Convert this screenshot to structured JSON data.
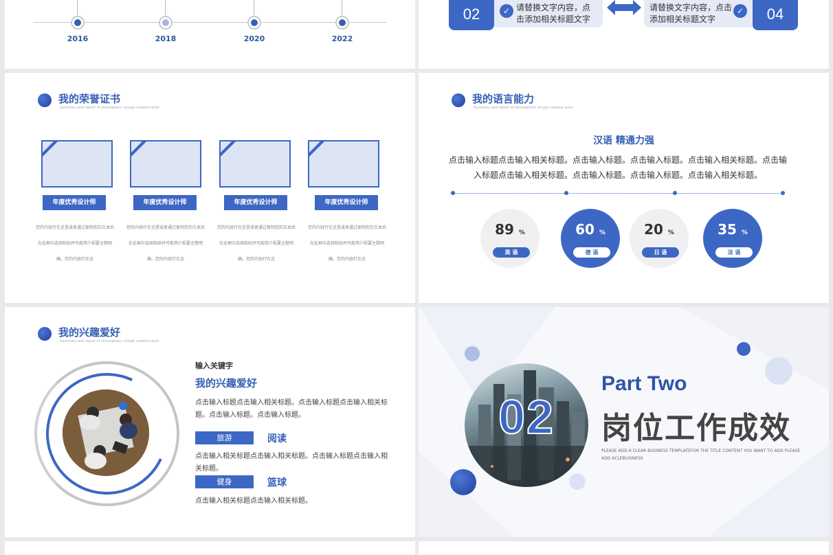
{
  "timeline": {
    "years": [
      "2016",
      "2018",
      "2020",
      "2022"
    ]
  },
  "steps": {
    "left_num": "02",
    "left_text": "请替换文字内容，点击添加相关标题文字",
    "right_num": "04",
    "right_text": "请替换文字内容，点击添加相关标题文字",
    "check_icon": "check-icon",
    "arrow_icon": "double-arrow-icon"
  },
  "honors": {
    "title": "我的荣誉证书",
    "subtitle": "Summary and report of atmospheric simple creative work",
    "items": [
      {
        "label": "年度优秀设计师",
        "desc": "您的内容打在这里或者通过复制您的文本后在此框中选择粘贴并可能简介扼要主题明确。您的内容打在这"
      },
      {
        "label": "年度优秀设计师",
        "desc": "您的内容打在这里或者通过复制您的文本后在此框中选择粘贴并可能简介扼要主题明确。您的内容打在这"
      },
      {
        "label": "年度优秀设计师",
        "desc": "您的内容打在这里或者通过复制您的文本后在此框中选择粘贴并可能简介扼要主题明确。您的内容打在这"
      },
      {
        "label": "年度优秀设计师",
        "desc": "您的内容打在这里或者通过复制您的文本后在此框中选择粘贴并可能简介扼要主题明确。您的内容打在这"
      }
    ]
  },
  "language": {
    "title": "我的语言能力",
    "subtitle": "Summary and report of atmospheric simple creative work",
    "headline": "汉语 精通力强",
    "paragraph": "点击输入标题点击输入相关标题。点击输入标题。点击输入标题。点击输入相关标题。点击输入标题点击输入相关标题。点击输入标题。点击输入标题。点击输入相关标题。",
    "items": [
      {
        "value": "89",
        "unit": "%",
        "name": "英 语",
        "style": "grey"
      },
      {
        "value": "60",
        "unit": "%",
        "name": "德 语",
        "style": "blue"
      },
      {
        "value": "20",
        "unit": "%",
        "name": "日 语",
        "style": "grey"
      },
      {
        "value": "35",
        "unit": "%",
        "name": "法 语",
        "style": "blue"
      }
    ]
  },
  "hobbies": {
    "title": "我的兴趣爱好",
    "subtitle": "Summary and report of atmospheric simple creative work",
    "keyword": "输入关键字",
    "heading": "我的兴趣爱好",
    "text1": "点击输入标题点击输入相关标题。点击输入标题点击输入相关标题。点击输入标题。点击输入标题。",
    "tag1": "旅游",
    "item1": "阅读",
    "text2": "点击输入相关标题点击输入相关标题。点击输入标题点击输入相关标题。",
    "tag2": "健身",
    "item2": "篮球",
    "text3": "点击输入相关标题点击输入相关标题。"
  },
  "section_two": {
    "number": "02",
    "part": "Part Two",
    "title": "岗位工作成效",
    "subtitle": "PLEASE ADD A CLEAR BUSINESS TEMPLATEFOR THE TITLE CONTENT YOU WANT TO ADD PLEASE ADD ACLEBUSINESS"
  },
  "colors": {
    "accent": "#3d67c4",
    "title": "#3660b4",
    "background": "#e9e9ec"
  }
}
